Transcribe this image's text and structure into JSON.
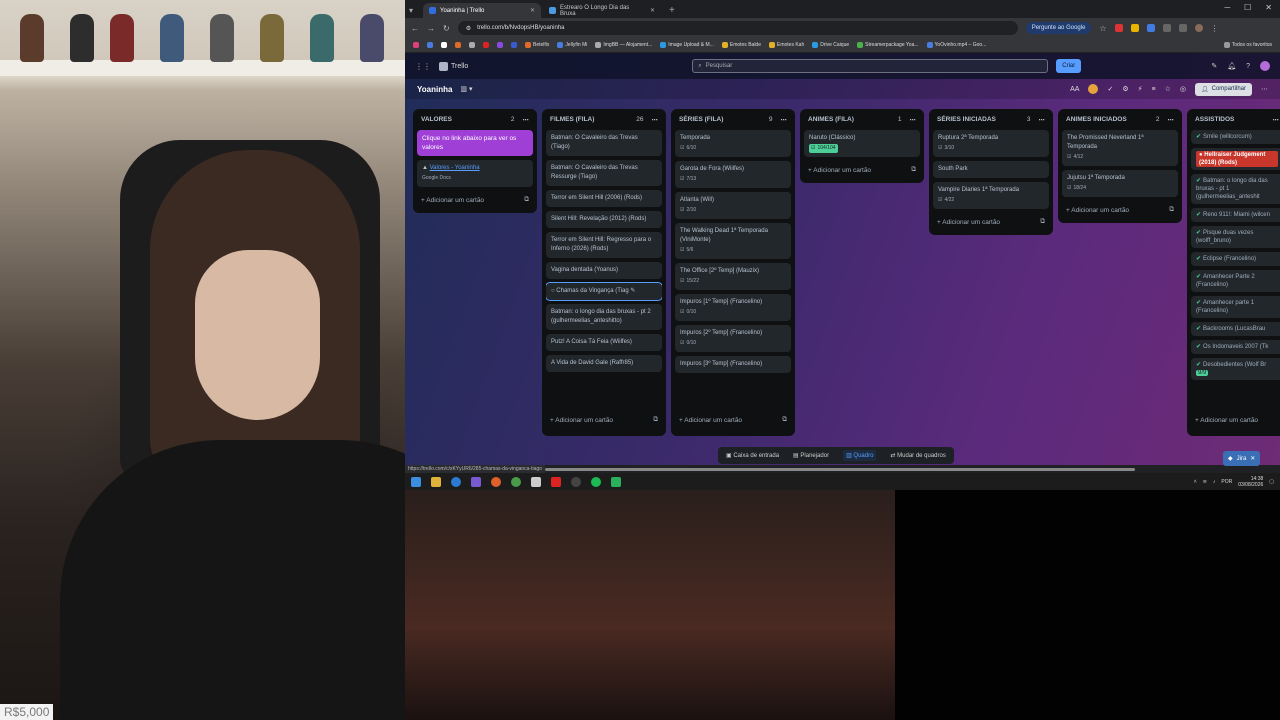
{
  "stream": {
    "donation_goal": "R$5,000"
  },
  "browser": {
    "tabs": [
      {
        "title": "Yoaninha | Trello",
        "active": true
      },
      {
        "title": "Estrearo O Longo Dia das Bruxa",
        "active": false
      }
    ],
    "url": "trello.com/b/NvdopsHB/yoaninha",
    "google_button": "Pergunte ao Google",
    "bookmarks": [
      "Betelfix",
      "Jellyfin Mi",
      "ImgBB — Alojament...",
      "Image Upload & M...",
      "Emotes Balde",
      "Emotes Kah",
      "Drive Caique",
      "Streamerpackage Yoa...",
      "YoOvinho.mp4 – Goo..."
    ],
    "all_bookmarks": "Todos os favoritos",
    "status_url": "https://trello.com/c/xKYyUR6/285-chamas-da-vinganca-tiago"
  },
  "trello": {
    "logo": "Trello",
    "search_placeholder": "Pesquisar",
    "create_label": "Criar",
    "board_name": "Yoaninha",
    "share_label": "Compartilhar",
    "add_card_label": "+ Adicionar um cartão",
    "lists": [
      {
        "title": "VALORES",
        "count": "2",
        "cards": [
          {
            "text": "Clique no link abaixo para ver os valores",
            "style": "purple"
          },
          {
            "text": "Valores - Yoaninha",
            "sub": "Google Docs",
            "style": "doc"
          }
        ]
      },
      {
        "title": "FILMES (FILA)",
        "count": "26",
        "cards": [
          {
            "text": "Batman: O Cavaleiro das Trevas (Tiago)"
          },
          {
            "text": "Batman: O Cavaleiro das Trevas Ressurge (Tiago)"
          },
          {
            "text": "Terror em Silent Hill (2006) (Rods)"
          },
          {
            "text": "Silent Hill: Revelação (2012) (Rods)"
          },
          {
            "text": "Terror em Silent Hill: Regresso para o Inferno (2026) (Rods)"
          },
          {
            "text": "Vagina dentada (Yoanus)"
          },
          {
            "text": "Chamas da Vingança (Tiag",
            "style": "highlight"
          },
          {
            "text": "Batman: o longo dia das bruxas - pt 2 (gulhermeelias_anteshitto)"
          },
          {
            "text": "Putz! A Coisa Tá Feia (Wiilfes)"
          },
          {
            "text": "A Vida de David Gale (Raffr85)"
          }
        ]
      },
      {
        "title": "SÉRIES (FILA)",
        "count": "9",
        "cards": [
          {
            "text": "Temporada",
            "badge": "6/10"
          },
          {
            "text": "Garota de Fora (Wiilfes)",
            "badge": "7/13"
          },
          {
            "text": "Atlanta (Will)",
            "badge": "2/10"
          },
          {
            "text": "The Walking Dead 1ª Temporada (ViniMonte)",
            "badge": "5/6"
          },
          {
            "text": "The Office [2º Temp] (Mauzix)",
            "badge": "15/22"
          },
          {
            "text": "Impuros [1º Temp] (Francelino)",
            "badge": "0/10"
          },
          {
            "text": "Impuros [2º Temp] (Francelino)",
            "badge": "0/10"
          },
          {
            "text": "Impuros [3º Temp] (Francelino)"
          }
        ]
      },
      {
        "title": "ANIMES (FILA)",
        "count": "1",
        "cards": [
          {
            "text": "Naruto (Clássico)",
            "badge": "104/104",
            "badge_green": true
          }
        ]
      },
      {
        "title": "SÉRIES INICIADAS",
        "count": "3",
        "cards": [
          {
            "text": "Ruptura 2ª Temporada",
            "badge": "3/10"
          },
          {
            "text": "South Park"
          },
          {
            "text": "Vampire Diaries 1ª Temporada",
            "badge": "4/22"
          }
        ]
      },
      {
        "title": "ANIMES INICIADOS",
        "count": "2",
        "cards": [
          {
            "text": "The Promissed Neverland 1ª Temporada",
            "badge": "4/12"
          },
          {
            "text": "Jujutsu 1ª Temporada",
            "badge": "18/24"
          }
        ]
      },
      {
        "title": "ASSISTIDOS",
        "count": "",
        "cards": [
          {
            "text": "Smile (willcorcum)"
          },
          {
            "text": "Hellraiser Judgement (2018) (Rods)",
            "style": "red"
          },
          {
            "text": "Batman: o longo dia das bruxas - pt 1 (gulhermeelias_anteshit"
          },
          {
            "text": "Reno 911!: Miami (wilcen"
          },
          {
            "text": "Pisque duas vezes (wolff_bruno)"
          },
          {
            "text": "Eclipse (Francelino)"
          },
          {
            "text": "Amanhecer Parte 2 (Francelino)"
          },
          {
            "text": "Amanhecer parte 1 (Francelino)"
          },
          {
            "text": "Backrooms (LucasBrau"
          },
          {
            "text": "Os Indomaveis 2007 (Tk"
          },
          {
            "text": "Desobedientes (Wolf Br",
            "badge": "9/9",
            "badge_green": true
          }
        ]
      }
    ],
    "bottom_nav": [
      "Caixa de entrada",
      "Planejador",
      "Quadro",
      "Mudar de quadros"
    ],
    "jira_label": "Jira"
  },
  "taskbar": {
    "lang": "POR",
    "time": "14:38",
    "date": "03/08/2026"
  }
}
